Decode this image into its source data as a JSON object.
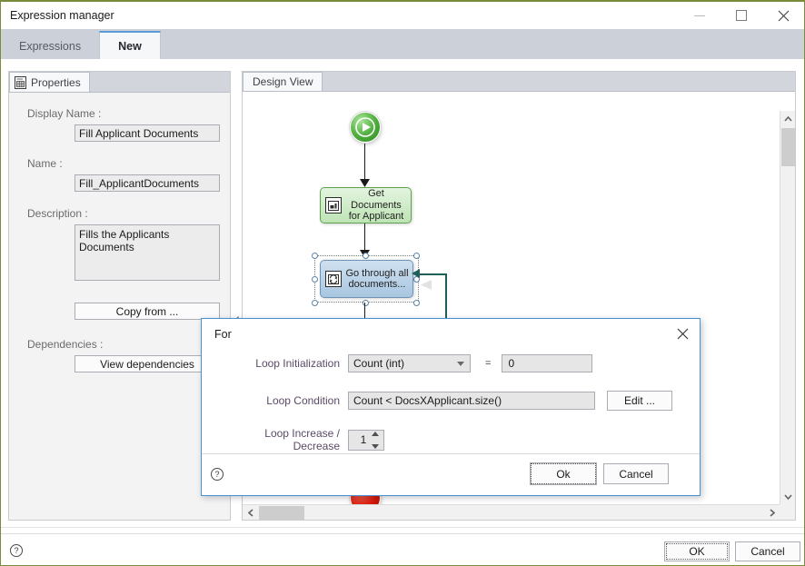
{
  "window": {
    "title": "Expression manager",
    "controls": {
      "minimize": "minimize-icon",
      "maximize": "maximize-icon",
      "close": "close-icon"
    },
    "accent_border": "#7a8b3a"
  },
  "tabs": [
    {
      "label": "Expressions",
      "active": false
    },
    {
      "label": "New",
      "active": true
    }
  ],
  "properties_panel": {
    "tab_label": "Properties",
    "tab_icon": "properties-icon",
    "fields": {
      "display_name_label": "Display Name :",
      "display_name_value": "Fill Applicant Documents",
      "name_label": "Name :",
      "name_value": "Fill_ApplicantDocuments",
      "description_label": "Description :",
      "description_value": "Fills the Applicants Documents"
    },
    "copy_from_label": "Copy from ...",
    "dependencies_label": "Dependencies :",
    "view_dependencies_label": "View dependencies"
  },
  "splitter": {
    "collapse_icon": "collapse-left-arrow-icon",
    "grip": "drag-grip-icon"
  },
  "design_view": {
    "tab_label": "Design View",
    "nodes": [
      {
        "id": "start",
        "type": "start",
        "label": "",
        "icon": "play-icon",
        "color": "#4fae3c"
      },
      {
        "id": "get-docs",
        "type": "task",
        "label": "Get Documents for Applicant",
        "icon": "document-task-icon",
        "color": "#bfe4b6"
      },
      {
        "id": "loop",
        "type": "loop",
        "label": "Go through all documents...",
        "icon": "loop-icon",
        "color": "#a8c6e0",
        "selected": true
      },
      {
        "id": "end",
        "type": "end",
        "label": "",
        "icon": "stop-icon",
        "color": "#d81a0b"
      }
    ],
    "vertical_scrollbar": {
      "up": "chevron-up-icon",
      "down": "chevron-down-icon"
    },
    "horizontal_scrollbar": {
      "left": "chevron-left-icon",
      "right": "chevron-right-icon"
    }
  },
  "dialog": {
    "title": "For",
    "close_icon": "close-icon",
    "loop_initialization_label": "Loop Initialization",
    "loop_initialization_value": "Count (int)",
    "equals_sign": "=",
    "loop_initialization_amount": "0",
    "loop_condition_label": "Loop Condition",
    "loop_condition_value": "Count < DocsXApplicant.size()",
    "edit_label": "Edit ...",
    "loop_step_label": "Loop Increase / Decrease",
    "loop_step_value": "1",
    "ok_label": "Ok",
    "cancel_label": "Cancel",
    "help_label": "?",
    "accent_color": "#4a8fd0"
  },
  "footer": {
    "help_label": "?",
    "ok_label": "OK",
    "cancel_label": "Cancel"
  }
}
